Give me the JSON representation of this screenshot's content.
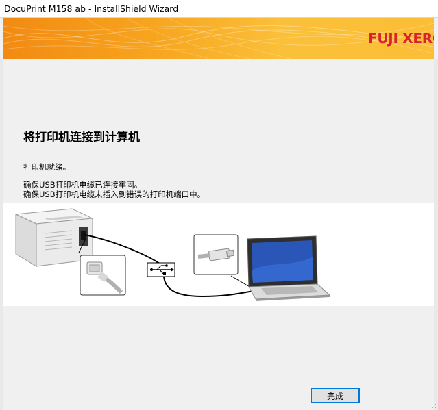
{
  "window": {
    "title": "DocuPrint M158 ab - InstallShield Wizard"
  },
  "banner": {
    "brand": "FUJI XEROX",
    "logo_icon": "fuji-xerox-sphere-icon",
    "colors": {
      "accent_start": "#f28a12",
      "accent_end": "#fbbe36",
      "brand_red": "#d8232a"
    }
  },
  "main": {
    "heading": "将打印机连接到计算机",
    "status": "打印机就绪。",
    "notes": [
      "确保USB打印机电缆已连接牢固。",
      "确保USB打印机电缆未插入到错误的打印机端口中。"
    ]
  },
  "illustration": {
    "items": [
      "printer-icon",
      "usb-b-plug-icon",
      "usb-symbol-icon",
      "usb-a-plug-icon",
      "laptop-icon"
    ]
  },
  "footer": {
    "finish_label": "完成"
  }
}
